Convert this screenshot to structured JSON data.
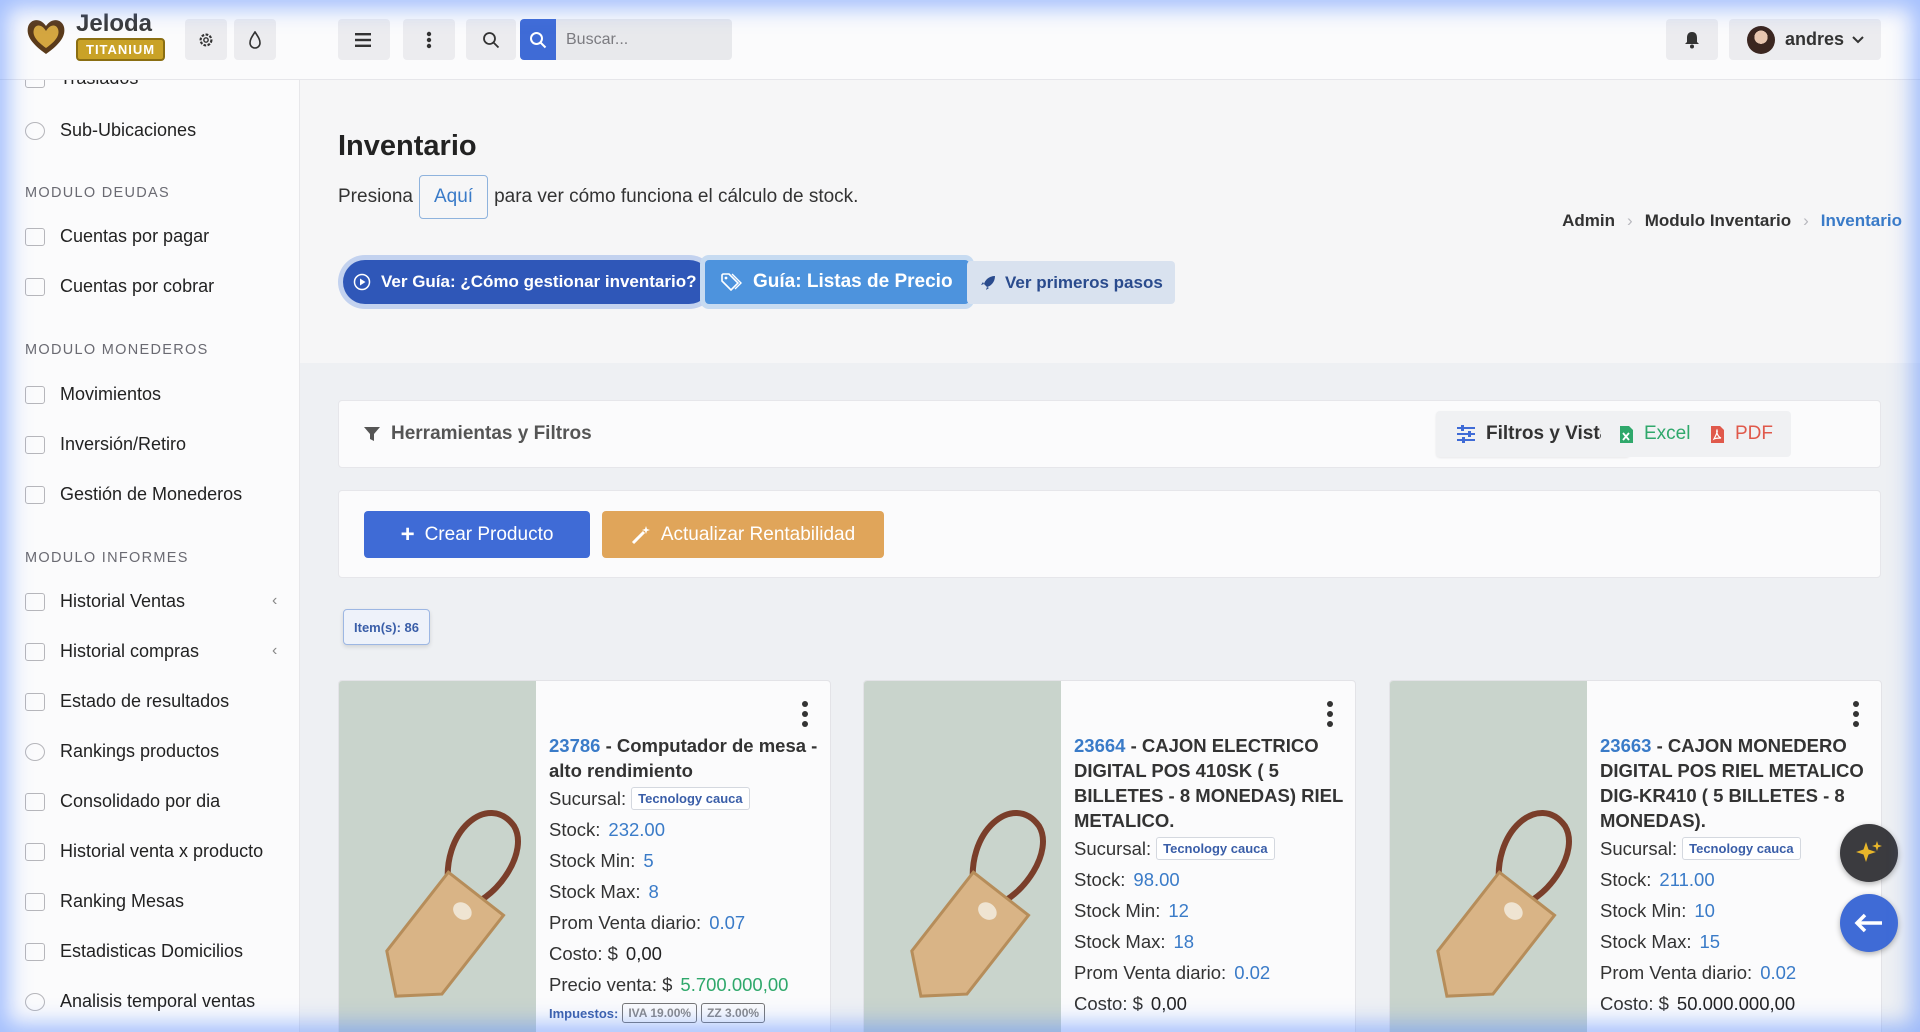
{
  "brand": {
    "name": "Jeloda",
    "badge": "TITANIUM"
  },
  "topbar": {
    "search_placeholder": "Buscar...",
    "user_name": "andres"
  },
  "sidebar": {
    "items_top": [
      {
        "label": "Traslados"
      },
      {
        "label": "Sub-Ubicaciones"
      }
    ],
    "sections": [
      {
        "title": "MODULO DEUDAS",
        "items": [
          "Cuentas por pagar",
          "Cuentas por cobrar"
        ]
      },
      {
        "title": "MODULO MONEDEROS",
        "items": [
          "Movimientos",
          "Inversión/Retiro",
          "Gestión de Monederos"
        ]
      },
      {
        "title": "MODULO INFORMES",
        "items": [
          "Historial Ventas",
          "Historial compras",
          "Estado de resultados",
          "Rankings productos",
          "Consolidado por dia",
          "Historial venta x producto",
          "Ranking Mesas",
          "Estadisticas Domicilios",
          "Analisis temporal ventas"
        ]
      }
    ]
  },
  "page": {
    "title": "Inventario",
    "intro_before": "Presiona",
    "intro_link": "Aquí",
    "intro_after": "para ver cómo funciona el cálculo de stock.",
    "breadcrumb": [
      "Admin",
      "Modulo Inventario",
      "Inventario"
    ],
    "guides": [
      "Ver Guía: ¿Cómo gestionar inventario?",
      "Guía: Listas de Precio",
      "Ver primeros pasos"
    ]
  },
  "tools": {
    "title": "Herramientas y Filtros",
    "filters": "Filtros y Vista",
    "excel": "Excel",
    "pdf": "PDF"
  },
  "actions": {
    "create": "Crear Producto",
    "update": "Actualizar Rentabilidad"
  },
  "items_count": "Item(s): 86",
  "labels": {
    "sucursal": "Sucursal:",
    "stock": "Stock:",
    "stock_min": "Stock Min:",
    "stock_max": "Stock Max:",
    "prom": "Prom Venta diario:",
    "costo": "Costo: $",
    "precio": "Precio venta: $",
    "impuestos": "Impuestos:"
  },
  "products": [
    {
      "code": "23786",
      "name": "- Computador de mesa - alto rendimiento",
      "sucursal": "Tecnology cauca",
      "stock": "232.00",
      "stock_min": "5",
      "stock_max": "8",
      "prom": "0.07",
      "costo": "0,00",
      "precio": "5.700.000,00",
      "taxes": [
        "IVA 19.00%",
        "ZZ 3.00%"
      ]
    },
    {
      "code": "23664",
      "name": "- CAJON ELECTRICO DIGITAL POS 410SK ( 5 BILLETES - 8 MONEDAS) RIEL METALICO.",
      "sucursal": "Tecnology cauca",
      "stock": "98.00",
      "stock_min": "12",
      "stock_max": "18",
      "prom": "0.02",
      "costo": "0,00"
    },
    {
      "code": "23663",
      "name": "- CAJON MONEDERO DIGITAL POS RIEL METALICO DIG-KR410 ( 5 BILLETES - 8 MONEDAS).",
      "sucursal": "Tecnology cauca",
      "stock": "211.00",
      "stock_min": "10",
      "stock_max": "15",
      "prom": "0.02",
      "costo": "50.000.000,00"
    }
  ]
}
